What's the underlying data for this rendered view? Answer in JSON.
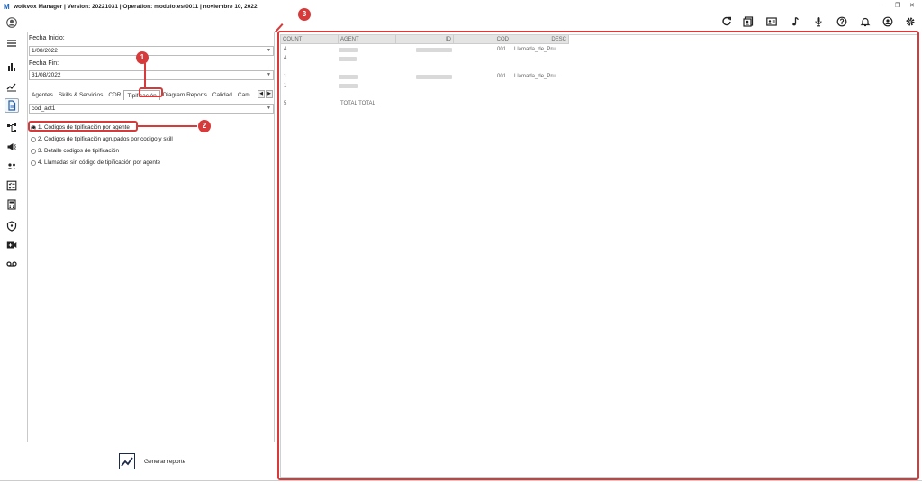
{
  "window": {
    "title": "wolkvox Manager  | Version: 20221031 |  Operation: modulotest0011 | noviembre 10, 2022",
    "logo_text": "M",
    "controls": [
      "–",
      "❐",
      "✕"
    ]
  },
  "toolbar": {
    "icons": [
      "refresh-icon",
      "contacts-book-icon",
      "id-card-icon",
      "music-note-icon",
      "microphone-icon",
      "help-icon",
      "bell-icon",
      "user-icon",
      "gear-icon"
    ]
  },
  "sidebar": {
    "icons": [
      "menu-icon",
      "bar-chart-icon",
      "trend-chart-icon",
      "report-icon",
      "hierarchy-icon",
      "megaphone-icon",
      "users-group-icon",
      "checklist-icon",
      "calculator-icon",
      "shield-icon",
      "video-call-icon",
      "voicemail-icon"
    ]
  },
  "filters": {
    "fecha_inicio_label": "Fecha Inicio:",
    "fecha_inicio_value": "1/08/2022",
    "fecha_fin_label": "Fecha Fin:",
    "fecha_fin_value": "31/08/2022",
    "tabs": [
      "Agentes",
      "Skills & Servicios",
      "CDR",
      "Tipificación",
      "Diagram Reports",
      "Calidad",
      "Cam"
    ],
    "active_tab": "Tipificación",
    "code_select_value": "cod_act1"
  },
  "options": [
    {
      "label": "1. Códigos de tipificación por agente",
      "checked": true
    },
    {
      "label": "2. Códigos de tipificación agrupados por codigo y skill",
      "checked": false
    },
    {
      "label": "3. Detalle códigos de tipificación",
      "checked": false
    },
    {
      "label": "4. Llamadas sin código de tipificación por agente",
      "checked": false
    }
  ],
  "generate_button": {
    "label": "Generar reporte"
  },
  "grid": {
    "columns": [
      "COUNT",
      "AGENT",
      "ID",
      "COD",
      "DESC"
    ],
    "rows": [
      {
        "count": "4",
        "cod": "001",
        "desc": "Llamada_de_Pru..."
      },
      {
        "count": "4",
        "cod": "",
        "desc": ""
      },
      {
        "count": "1",
        "cod": "001",
        "desc": "Llamada_de_Pru..."
      },
      {
        "count": "1",
        "cod": "",
        "desc": ""
      },
      {
        "count": "5",
        "agent": "TOTAL TOTAL",
        "cod": "",
        "desc": ""
      }
    ]
  },
  "annotations": {
    "badges": [
      "1",
      "2",
      "3"
    ],
    "color": "#d63a3a"
  }
}
